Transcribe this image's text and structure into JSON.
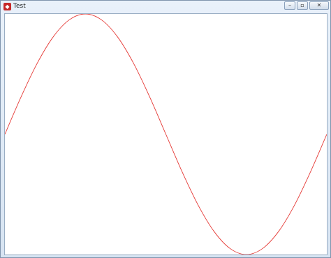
{
  "window": {
    "title": "Test",
    "app_icon": "app-icon",
    "menu_hints": [
      "",
      "",
      "",
      "",
      ""
    ],
    "buttons": {
      "minimize": "minimize-icon",
      "maximize": "maximize-icon",
      "close": "close-icon"
    }
  },
  "chart_data": {
    "type": "line",
    "title": "",
    "xlabel": "",
    "ylabel": "",
    "grid": false,
    "color": "#e53935",
    "xlim": [
      0,
      6.2832
    ],
    "ylim": [
      -1,
      1
    ],
    "series": [
      {
        "x": [
          0,
          0.3142,
          0.6283,
          0.9425,
          1.2566,
          1.5708,
          1.885,
          2.1991,
          2.5133,
          2.8274,
          3.1416,
          3.4558,
          3.7699,
          4.0841,
          4.3982,
          4.7124,
          5.0265,
          5.3407,
          5.6549,
          5.969,
          6.2832
        ],
        "y": [
          0,
          0.309,
          0.5878,
          0.809,
          0.9511,
          1.0,
          0.9511,
          0.809,
          0.5878,
          0.309,
          0,
          -0.309,
          -0.5878,
          -0.809,
          -0.9511,
          -1.0,
          -0.9511,
          -0.809,
          -0.5878,
          -0.309,
          0
        ]
      }
    ]
  }
}
